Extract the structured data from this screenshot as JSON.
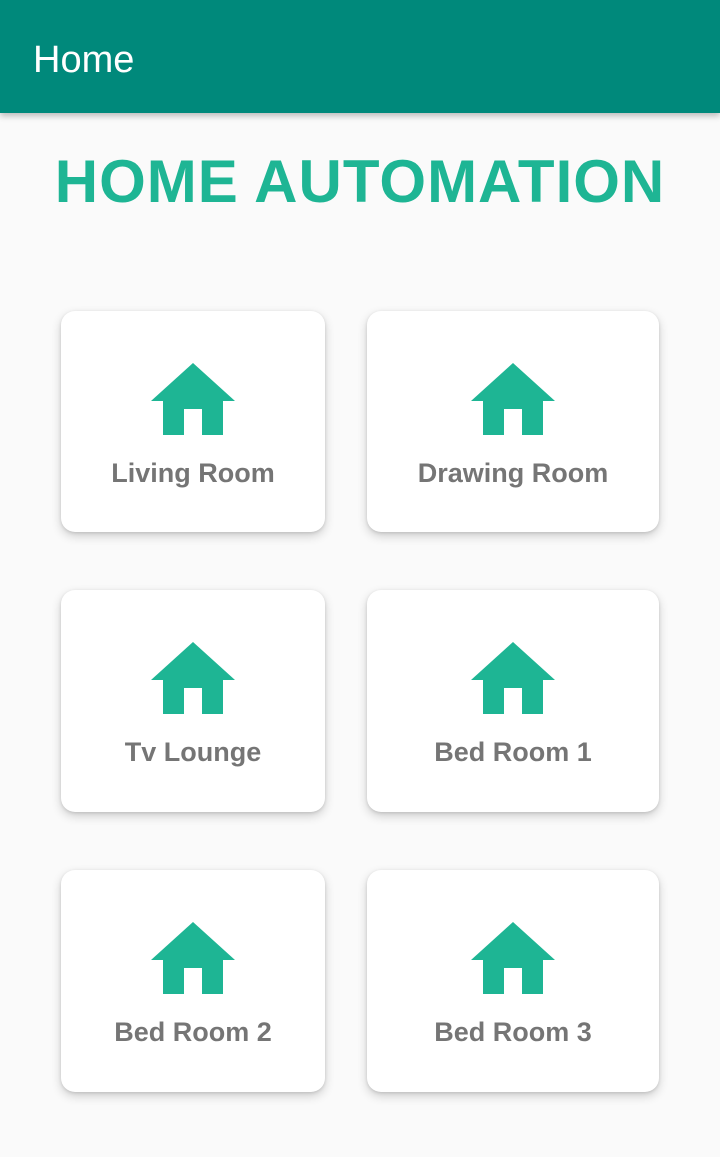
{
  "app_bar": {
    "title": "Home",
    "background_color": "#00897b"
  },
  "page": {
    "title": "HOME AUTOMATION",
    "title_color": "#1eb594"
  },
  "rooms": [
    {
      "label": "Living Room",
      "icon": "home-icon"
    },
    {
      "label": "Drawing Room",
      "icon": "home-icon"
    },
    {
      "label": "Tv Lounge",
      "icon": "home-icon"
    },
    {
      "label": "Bed Room 1",
      "icon": "home-icon"
    },
    {
      "label": "Bed Room 2",
      "icon": "home-icon"
    },
    {
      "label": "Bed Room 3",
      "icon": "home-icon"
    }
  ],
  "colors": {
    "accent": "#1eb594",
    "label": "#757575",
    "card": "#ffffff",
    "background": "#fafafa"
  }
}
